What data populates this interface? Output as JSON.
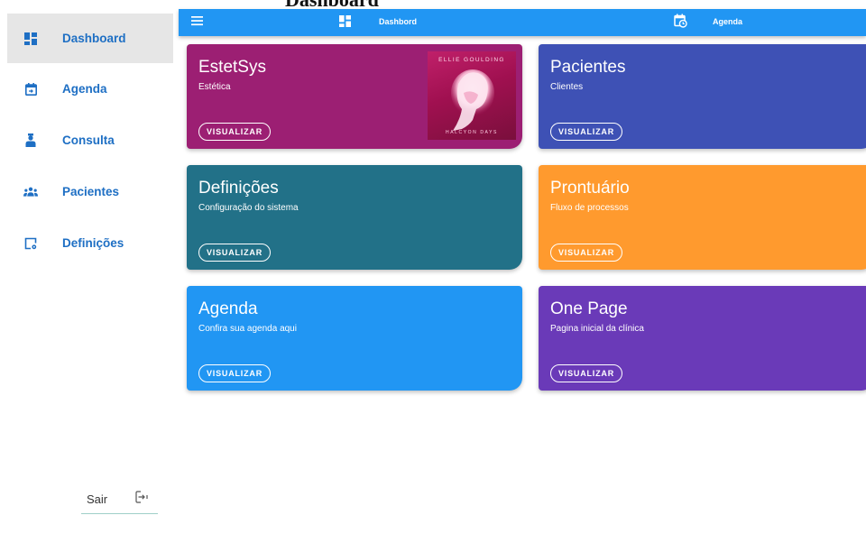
{
  "page": {
    "title": "Dashboard"
  },
  "sidebar": {
    "items": [
      {
        "label": "Dashboard",
        "icon": "dashboard-icon",
        "active": true
      },
      {
        "label": "Agenda",
        "icon": "calendar-icon",
        "active": false
      },
      {
        "label": "Consulta",
        "icon": "doctor-icon",
        "active": false
      },
      {
        "label": "Pacientes",
        "icon": "people-icon",
        "active": false
      },
      {
        "label": "Definições",
        "icon": "settings-window-icon",
        "active": false
      }
    ],
    "logout": {
      "label": "Sair",
      "icon": "logout-icon"
    }
  },
  "topbar": {
    "menu_icon": "menu-icon",
    "dashboard": {
      "label": "Dashbord",
      "icon": "dashboard-icon"
    },
    "agenda": {
      "label": "Agenda",
      "icon": "calendar-clock-icon"
    }
  },
  "cards": [
    {
      "title": "EstetSys",
      "subtitle": "Estética",
      "button": "VISUALIZAR",
      "color": "#9c1f73",
      "image": {
        "artist": "ELLIE GOULDING",
        "album": "HALCYON DAYS"
      }
    },
    {
      "title": "Pacientes",
      "subtitle": "Clientes",
      "button": "VISUALIZAR",
      "color": "#3e51b5"
    },
    {
      "title": "Definições",
      "subtitle": "Configuração do sistema",
      "button": "VISUALIZAR",
      "color": "#227188"
    },
    {
      "title": "Prontuário",
      "subtitle": "Fluxo de processos",
      "button": "VISUALIZAR",
      "color": "#ff9a2e"
    },
    {
      "title": "Agenda",
      "subtitle": "Confira sua agenda aqui",
      "button": "VISUALIZAR",
      "color": "#2196f3"
    },
    {
      "title": "One Page",
      "subtitle": "Pagina inicial da clínica",
      "button": "VISUALIZAR",
      "color": "#6a3ab8"
    }
  ],
  "colors": {
    "accent": "#2196f3",
    "nav_text": "#1e6fc4",
    "active_bg": "#e6e6e6"
  }
}
